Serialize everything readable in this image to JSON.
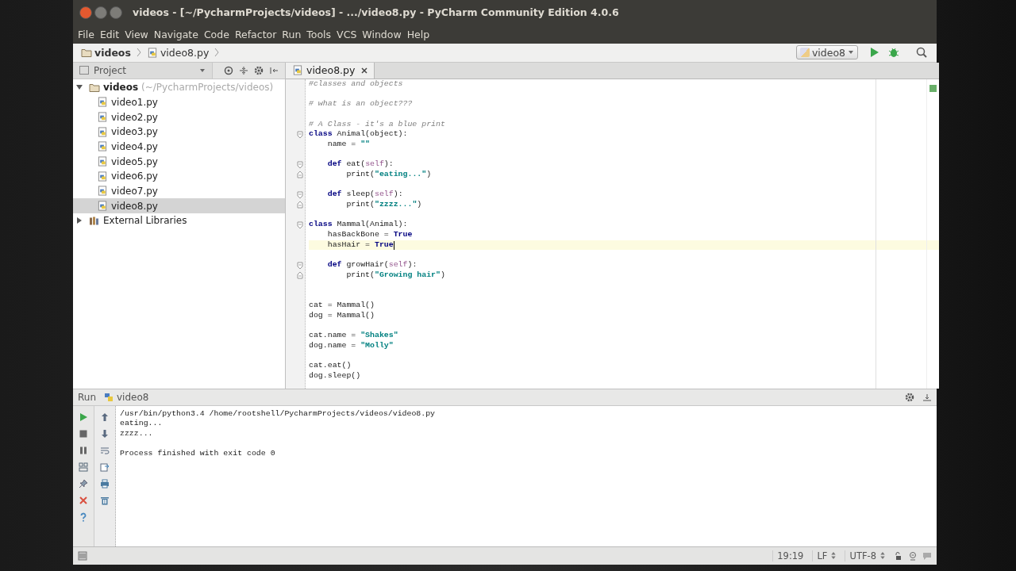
{
  "window": {
    "title": "videos - [~/PycharmProjects/videos] - .../video8.py - PyCharm Community Edition 4.0.6"
  },
  "menu": [
    "File",
    "Edit",
    "View",
    "Navigate",
    "Code",
    "Refactor",
    "Run",
    "Tools",
    "VCS",
    "Window",
    "Help"
  ],
  "breadcrumbs": [
    {
      "label": "videos",
      "kind": "folder"
    },
    {
      "label": "video8.py",
      "kind": "file"
    }
  ],
  "run_config": "video8",
  "project_panel": {
    "title": "Project",
    "tree": [
      {
        "label": "videos",
        "path": "(~/PycharmProjects/videos)",
        "kind": "folder",
        "expanded": true,
        "selected": false,
        "children": [
          {
            "label": "video1.py",
            "kind": "file",
            "selected": false
          },
          {
            "label": "video2.py",
            "kind": "file",
            "selected": false
          },
          {
            "label": "video3.py",
            "kind": "file",
            "selected": false
          },
          {
            "label": "video4.py",
            "kind": "file",
            "selected": false
          },
          {
            "label": "video5.py",
            "kind": "file",
            "selected": false
          },
          {
            "label": "video6.py",
            "kind": "file",
            "selected": false
          },
          {
            "label": "video7.py",
            "kind": "file",
            "selected": false
          },
          {
            "label": "video8.py",
            "kind": "file",
            "selected": true
          }
        ]
      },
      {
        "label": "External Libraries",
        "kind": "library",
        "expanded": false,
        "selected": false
      }
    ]
  },
  "editor_tabs": [
    {
      "label": "video8.py",
      "selected": true
    }
  ],
  "code": [
    {
      "current": false,
      "segments": [
        {
          "kind": "comment",
          "text": "#classes and objects"
        }
      ]
    },
    {
      "current": false
    },
    {
      "current": false,
      "segments": [
        {
          "kind": "comment",
          "text": "# what is an object???"
        }
      ]
    },
    {
      "current": false
    },
    {
      "current": false,
      "segments": [
        {
          "kind": "comment",
          "text": "# A Class - it's a blue print"
        }
      ]
    },
    {
      "current": false,
      "kind": "fold_start",
      "segments": [
        {
          "kind": "keyword",
          "text": "class "
        },
        {
          "kind": "plain",
          "text": "Animal(object):"
        }
      ]
    },
    {
      "current": false,
      "segments": [
        {
          "kind": "plain",
          "text": "    name = "
        },
        {
          "kind": "string",
          "text": "\"\""
        }
      ]
    },
    {
      "current": false
    },
    {
      "current": false,
      "kind": "fold_start",
      "segments": [
        {
          "kind": "keyword",
          "text": "    def "
        },
        {
          "kind": "plain",
          "text": "eat("
        },
        {
          "kind": "self",
          "text": "self"
        },
        {
          "kind": "plain",
          "text": "):"
        }
      ]
    },
    {
      "current": false,
      "kind": "fold_end",
      "segments": [
        {
          "kind": "plain",
          "text": "        print("
        },
        {
          "kind": "string",
          "text": "\"eating...\""
        },
        {
          "kind": "plain",
          "text": ")"
        }
      ]
    },
    {
      "current": false
    },
    {
      "current": false,
      "kind": "fold_start",
      "segments": [
        {
          "kind": "keyword",
          "text": "    def "
        },
        {
          "kind": "plain",
          "text": "sleep("
        },
        {
          "kind": "self",
          "text": "self"
        },
        {
          "kind": "plain",
          "text": "):"
        }
      ]
    },
    {
      "current": false,
      "kind": "fold_end",
      "segments": [
        {
          "kind": "plain",
          "text": "        print("
        },
        {
          "kind": "string",
          "text": "\"zzzz...\""
        },
        {
          "kind": "plain",
          "text": ")"
        }
      ]
    },
    {
      "current": false
    },
    {
      "current": false,
      "kind": "fold_start",
      "segments": [
        {
          "kind": "keyword",
          "text": "class "
        },
        {
          "kind": "plain",
          "text": "Mammal(Animal):"
        }
      ]
    },
    {
      "current": false,
      "segments": [
        {
          "kind": "plain",
          "text": "    hasBackBone = "
        },
        {
          "kind": "keyword",
          "text": "True"
        }
      ]
    },
    {
      "current": true,
      "segments": [
        {
          "kind": "plain",
          "text": "    hasHair = "
        },
        {
          "kind": "keyword",
          "text": "True"
        }
      ]
    },
    {
      "current": false
    },
    {
      "current": false,
      "kind": "fold_start",
      "segments": [
        {
          "kind": "keyword",
          "text": "    def "
        },
        {
          "kind": "plain",
          "text": "growHair("
        },
        {
          "kind": "self",
          "text": "self"
        },
        {
          "kind": "plain",
          "text": "):"
        }
      ]
    },
    {
      "current": false,
      "kind": "fold_end",
      "segments": [
        {
          "kind": "plain",
          "text": "        print("
        },
        {
          "kind": "string",
          "text": "\"Growing hair\""
        },
        {
          "kind": "plain",
          "text": ")"
        }
      ]
    },
    {
      "current": false
    },
    {
      "current": false
    },
    {
      "current": false,
      "segments": [
        {
          "kind": "plain",
          "text": "cat = Mammal()"
        }
      ]
    },
    {
      "current": false,
      "segments": [
        {
          "kind": "plain",
          "text": "dog = Mammal()"
        }
      ]
    },
    {
      "current": false
    },
    {
      "current": false,
      "segments": [
        {
          "kind": "plain",
          "text": "cat.name = "
        },
        {
          "kind": "string",
          "text": "\"Shakes\""
        }
      ]
    },
    {
      "current": false,
      "segments": [
        {
          "kind": "plain",
          "text": "dog.name = "
        },
        {
          "kind": "string",
          "text": "\"Molly\""
        }
      ]
    },
    {
      "current": false
    },
    {
      "current": false,
      "segments": [
        {
          "kind": "plain",
          "text": "cat.eat()"
        }
      ]
    },
    {
      "current": false,
      "segments": [
        {
          "kind": "plain",
          "text": "dog.sleep()"
        }
      ]
    }
  ],
  "run_panel": {
    "title": "Run",
    "tab": "video8",
    "output": [
      {
        "kind": "command",
        "text": "/usr/bin/python3.4 /home/rootshell/PycharmProjects/videos/video8.py"
      },
      {
        "kind": "output",
        "text": "eating..."
      },
      {
        "kind": "output",
        "text": "zzzz..."
      },
      {
        "kind": "exit",
        "text": "Process finished with exit code 0"
      }
    ]
  },
  "status_bar": {
    "position": "19:19",
    "line_separator": "LF",
    "encoding": "UTF-8"
  }
}
